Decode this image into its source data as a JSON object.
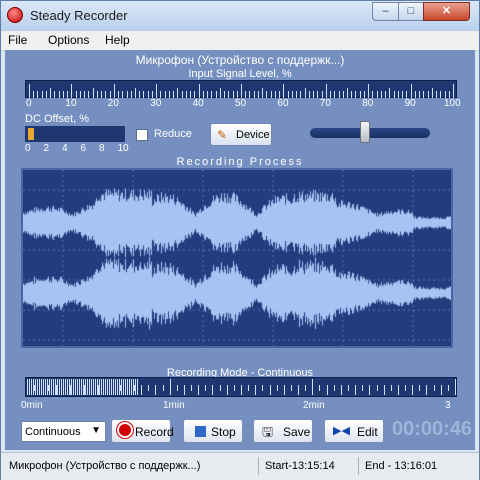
{
  "window": {
    "title": "Steady Recorder",
    "min_glyph": "–",
    "max_glyph": "□",
    "close_glyph": "✕"
  },
  "menu": [
    {
      "label": "File"
    },
    {
      "label": "Options"
    },
    {
      "label": "Help"
    }
  ],
  "device": {
    "name": "Микрофон (Устройство с поддержк...)"
  },
  "input_meter": {
    "label": "Input Signal Level, %",
    "scale": [
      "0",
      "10",
      "20",
      "30",
      "40",
      "50",
      "60",
      "70",
      "80",
      "90",
      "100"
    ]
  },
  "dc_offset": {
    "label": "DC Offset, %",
    "scale": [
      "0",
      "2",
      "4",
      "6",
      "8",
      "10"
    ],
    "level_percent": 0.6
  },
  "reduce": {
    "label": "Reduce",
    "checked": false
  },
  "device_button": {
    "label": "Device",
    "icon": "device-pencil-icon"
  },
  "gain_slider": {
    "value_fraction": 0.45
  },
  "recording": {
    "title": "Recording Process"
  },
  "timeline": {
    "title": "Recording Mode - Continuous",
    "ticks": [
      "0min",
      "1min",
      "2min",
      "3"
    ],
    "progress_fraction": 0.26
  },
  "controls": {
    "mode_select": "Continuous",
    "record_label": "Record",
    "stop_label": "Stop",
    "save_label": "Save",
    "edit_label": "Edit",
    "timer": "00:00:46"
  },
  "statusbar": {
    "device": "Микрофон (Устройство с поддержк...)",
    "start": "Start-13:15:14",
    "end": "End - 13:16:01"
  },
  "colors": {
    "panel_bg": "#7590c0",
    "meter_bg": "#1f3770",
    "wave_bg": "#213d7e",
    "wave": "#a7c3f3",
    "dc_fill": "#e7a834",
    "timer": "#9eb5da"
  }
}
